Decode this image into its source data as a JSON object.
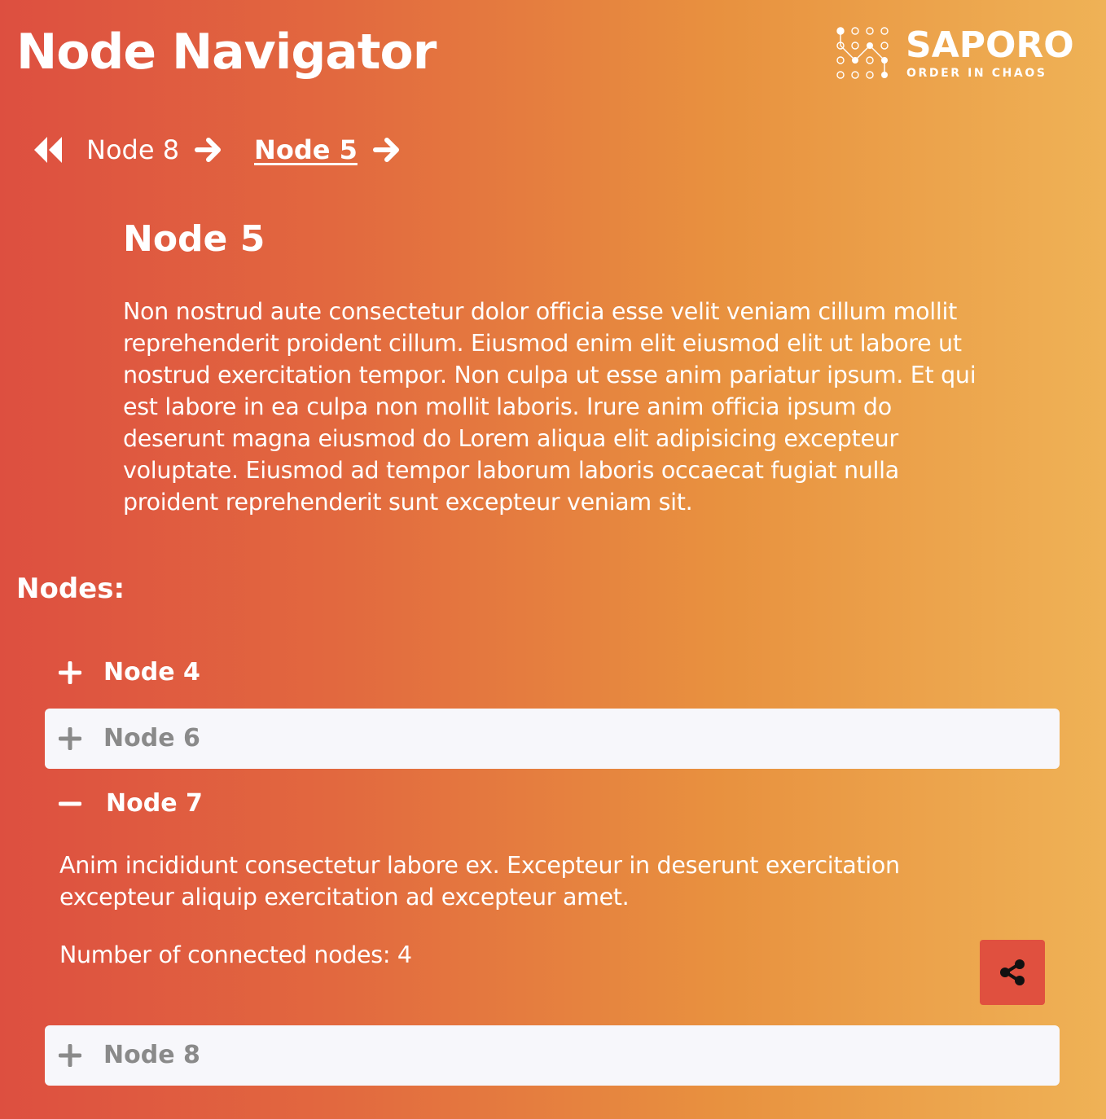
{
  "header": {
    "title": "Node Navigator",
    "logo": {
      "name": "SAPORO",
      "tagline": "ORDER IN CHAOS"
    }
  },
  "breadcrumb": {
    "back_icon": "double-chevron-left-icon",
    "arrow_icon": "arrow-right-icon",
    "items": [
      {
        "label": "Node 8",
        "current": false
      },
      {
        "label": "Node 5",
        "current": true
      }
    ]
  },
  "node": {
    "title": "Node 5",
    "description": "Non nostrud aute consectetur dolor officia esse velit veniam cillum mollit reprehenderit proident cillum. Eiusmod enim elit eiusmod elit ut labore ut nostrud exercitation tempor. Non culpa ut esse anim pariatur ipsum. Et qui est labore in ea culpa non mollit laboris. Irure anim officia ipsum do deserunt magna eiusmod do Lorem aliqua elit adipisicing excepteur voluptate. Eiusmod ad tempor laborum laboris occaecat fugiat nulla proident reprehenderit sunt excepteur veniam sit."
  },
  "nodes_section": {
    "label": "Nodes:",
    "items": [
      {
        "label": "Node 4",
        "expanded": false,
        "icon": "plus-icon"
      },
      {
        "label": "Node 6",
        "expanded": false,
        "icon": "plus-icon"
      },
      {
        "label": "Node 7",
        "expanded": true,
        "icon": "minus-icon",
        "description": "Anim incididunt consectetur labore ex. Excepteur in deserunt exercitation excepteur aliquip exercitation ad excepteur amet.",
        "connected_label": "Number of connected nodes: 4",
        "action_icon": "share-icon"
      },
      {
        "label": "Node 8",
        "expanded": false,
        "icon": "plus-icon"
      }
    ]
  },
  "colors": {
    "gradient_start": "#dd4f40",
    "gradient_end": "#efb256",
    "row_background": "#f7f7fb",
    "row_text": "#8a8a8a",
    "share_button": "#e0503f"
  }
}
